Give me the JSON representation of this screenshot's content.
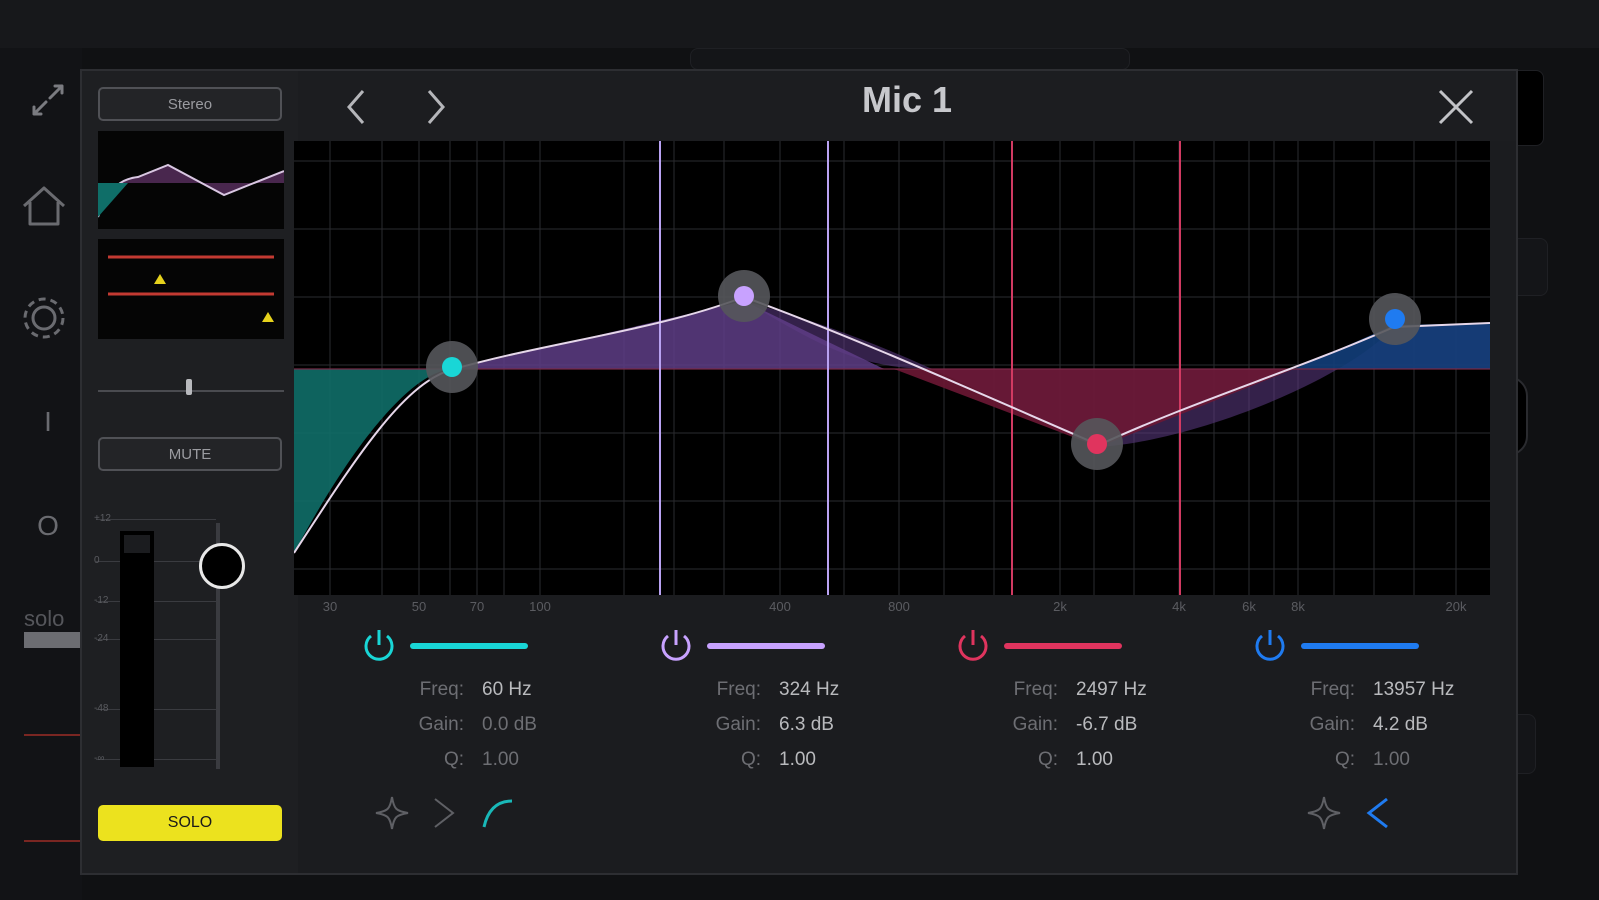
{
  "app": {
    "background_icons": [
      "collapse-arrows-icon",
      "home-icon",
      "gear-icon"
    ],
    "background_glyphs": {
      "divider": "I",
      "circle": "O"
    },
    "background_solo_label": "solo"
  },
  "modal": {
    "title": "Mic 1",
    "nav_prev_icon": "chevron-left-icon",
    "nav_next_icon": "chevron-right-icon",
    "close_icon": "close-x-icon"
  },
  "sidebar": {
    "stereo_label": "Stereo",
    "mute_label": "MUTE",
    "solo_label": "SOLO",
    "meter_scale": [
      "+12",
      "0",
      "-12",
      "-24",
      "-48",
      "-∞"
    ],
    "fader_level_db": 0
  },
  "colors": {
    "accent_solo": "#ece21e",
    "band1": "#19d6d6",
    "band2": "#c8a2ff",
    "band3": "#e0345e",
    "band4": "#1f7bf0",
    "curve": "#e6d7ea"
  },
  "eq": {
    "freq_axis_labels": [
      "30",
      "50",
      "70",
      "100",
      "400",
      "800",
      "2k",
      "4k",
      "6k",
      "8k",
      "20k"
    ],
    "bands": [
      {
        "id": "band1",
        "freq_label": "Freq:",
        "freq": "60 Hz",
        "gain_label": "Gain:",
        "gain": "0.0 dB",
        "q_label": "Q:",
        "q": "1.00",
        "enabled": true
      },
      {
        "id": "band2",
        "freq_label": "Freq:",
        "freq": "324 Hz",
        "gain_label": "Gain:",
        "gain": "6.3 dB",
        "q_label": "Q:",
        "q": "1.00",
        "enabled": true
      },
      {
        "id": "band3",
        "freq_label": "Freq:",
        "freq": "2497 Hz",
        "gain_label": "Gain:",
        "gain": "-6.7 dB",
        "q_label": "Q:",
        "q": "1.00",
        "enabled": true
      },
      {
        "id": "band4",
        "freq_label": "Freq:",
        "freq": "13957 Hz",
        "gain_label": "Gain:",
        "gain": "4.2 dB",
        "q_label": "Q:",
        "q": "1.00",
        "enabled": true
      }
    ],
    "shape_icons_left": [
      "bell-icon",
      "low-shelf-icon",
      "low-cut-icon"
    ],
    "shape_icons_right": [
      "bell-icon",
      "high-shelf-icon"
    ]
  }
}
